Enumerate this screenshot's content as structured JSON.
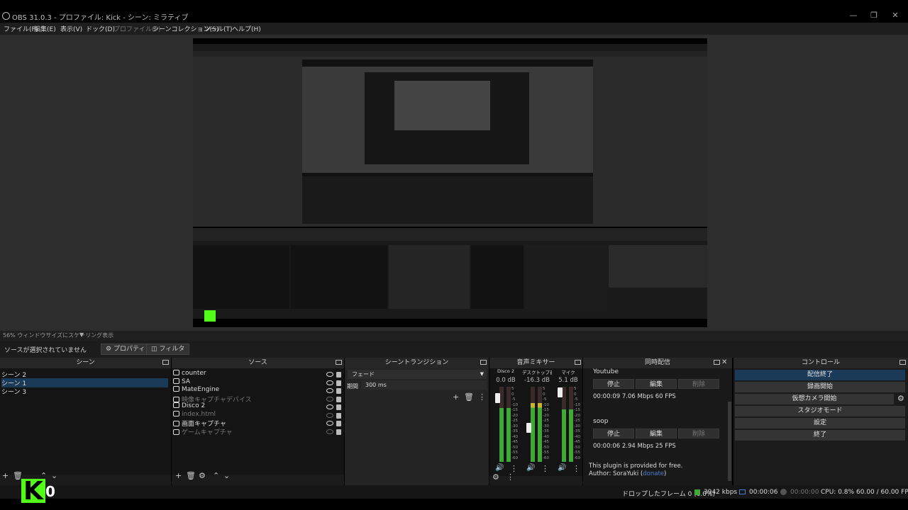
{
  "window": {
    "title": "OBS 31.0.3 - プロファイル: Kick - シーン: ミラティブ"
  },
  "menu": [
    {
      "label": "ファイル(F)",
      "disabled": false
    },
    {
      "label": "編集(E)",
      "disabled": false
    },
    {
      "label": "表示(V)",
      "disabled": false
    },
    {
      "label": "ドック(D)",
      "disabled": false
    },
    {
      "label": "プロファイル(P)",
      "disabled": true
    },
    {
      "label": "シーンコレクション(S)",
      "disabled": false
    },
    {
      "label": "ツール(T)",
      "disabled": false
    },
    {
      "label": "ヘルプ(H)",
      "disabled": false
    }
  ],
  "scalebar": {
    "label": "56% ウィンドウサイズにスケーリング表示"
  },
  "context": {
    "no_selection": "ソースが選択されていません",
    "properties": "プロパティ",
    "filters": "フィルタ"
  },
  "scenes": {
    "title": "シーン",
    "items": [
      {
        "label": "シーン 2",
        "selected": false
      },
      {
        "label": "シーン 1",
        "selected": true
      },
      {
        "label": "シーン 3",
        "selected": false
      }
    ]
  },
  "sources": {
    "title": "ソース",
    "items": [
      {
        "label": "counter",
        "icon": "text-icon",
        "visible": true
      },
      {
        "label": "SA",
        "icon": "window-icon",
        "visible": true
      },
      {
        "label": "MateEngine",
        "icon": "window-icon",
        "visible": true
      },
      {
        "label": "映像キャプチャデバイス",
        "icon": "camera-icon",
        "visible": false
      },
      {
        "label": "Disco 2",
        "icon": "camera-icon",
        "visible": true
      },
      {
        "label": "index.html",
        "icon": "globe-icon",
        "visible": false
      },
      {
        "label": "画面キャプチャ",
        "icon": "monitor-icon",
        "visible": true
      },
      {
        "label": "ゲームキャプチャ",
        "icon": "gamepad-icon",
        "visible": false
      }
    ]
  },
  "transitions": {
    "title": "シーントランジション",
    "type": "フェード",
    "duration_label": "期間",
    "duration_value": "300 ms"
  },
  "mixer": {
    "title": "音声ミキサー",
    "channels": [
      {
        "name": "Disco 2",
        "db": "0.0 dB",
        "level": 0.72,
        "fader": 0.85
      },
      {
        "name": "デスクトップ音声",
        "db": "-16.3 dB",
        "level": 0.78,
        "fader": 0.45
      },
      {
        "name": "マイク",
        "db": "5.1 dB",
        "level": 0.7,
        "fader": 0.92
      }
    ],
    "scale": [
      "5",
      "0",
      "-5",
      "-10",
      "-15",
      "-20",
      "-25",
      "-30",
      "-35",
      "-40",
      "-45",
      "-50",
      "-55",
      "-60"
    ]
  },
  "multistream": {
    "title": "同時配信",
    "outputs": [
      {
        "name": "Youtube",
        "stop": "停止",
        "edit": "編集",
        "delete": "削除",
        "stats": "00:00:09  7.06 Mbps  60 FPS"
      },
      {
        "name": "soop",
        "stop": "停止",
        "edit": "編集",
        "delete": "削除",
        "stats": "00:00:06  2.94 Mbps  25 FPS"
      }
    ],
    "footer1": "This plugin is provided for free.",
    "footer2": "Author: SoraYuki (",
    "footer_link": "donate",
    "footer3": ")"
  },
  "controls": {
    "title": "コントロール",
    "buttons": [
      "配信終了",
      "録画開始",
      "仮想カメラ開始",
      "スタジオモード",
      "設定",
      "終了"
    ]
  },
  "status": {
    "dropped": "ドロップしたフレーム 0 (0.0%)",
    "bitrate": "3942 kbps",
    "stream_time": "00:00:06",
    "rec_time": "00:00:00",
    "cpu": "CPU: 0.8%",
    "fps": "60.00 / 60.00 FPS"
  },
  "overlay": {
    "kick_letter": "K",
    "count": "0"
  },
  "colors": {
    "accent_selected": "#1b3a57",
    "kick_green": "#53fc18",
    "meter_green": "#3fa836",
    "meter_yellow": "#c9b431",
    "meter_red": "#b73030"
  }
}
